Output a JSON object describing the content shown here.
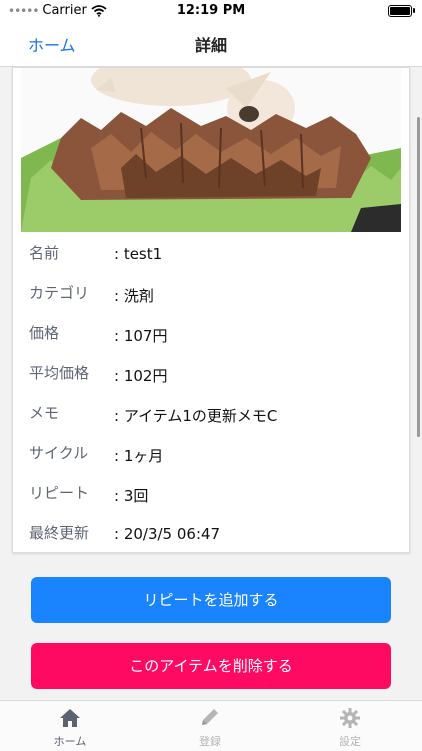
{
  "status": {
    "carrier": "Carrier",
    "time": "12:19 PM"
  },
  "nav": {
    "back_label": "ホーム",
    "title": "詳細"
  },
  "details": [
    {
      "label": "名前",
      "value": ": test1"
    },
    {
      "label": "カテゴリ",
      "value": ": 洗剤"
    },
    {
      "label": "価格",
      "value": ": 107円"
    },
    {
      "label": "平均価格",
      "value": ": 102円"
    },
    {
      "label": "メモ",
      "value": ": アイテム1の更新メモC"
    },
    {
      "label": "サイクル",
      "value": ": 1ヶ月"
    },
    {
      "label": "リピート",
      "value": ": 3回"
    },
    {
      "label": "最終更新",
      "value": ": 20/3/5 06:47"
    }
  ],
  "buttons": {
    "add_repeat": "リピートを追加する",
    "delete_item": "このアイテムを削除する"
  },
  "tabs": [
    {
      "label": "ホーム",
      "icon": "home-icon",
      "active": true
    },
    {
      "label": "登録",
      "icon": "pencil-icon",
      "active": false
    },
    {
      "label": "設定",
      "icon": "gear-icon",
      "active": false
    }
  ],
  "colors": {
    "accent": "#1a84ff",
    "danger": "#ff0a63",
    "link": "#1a73e8"
  }
}
